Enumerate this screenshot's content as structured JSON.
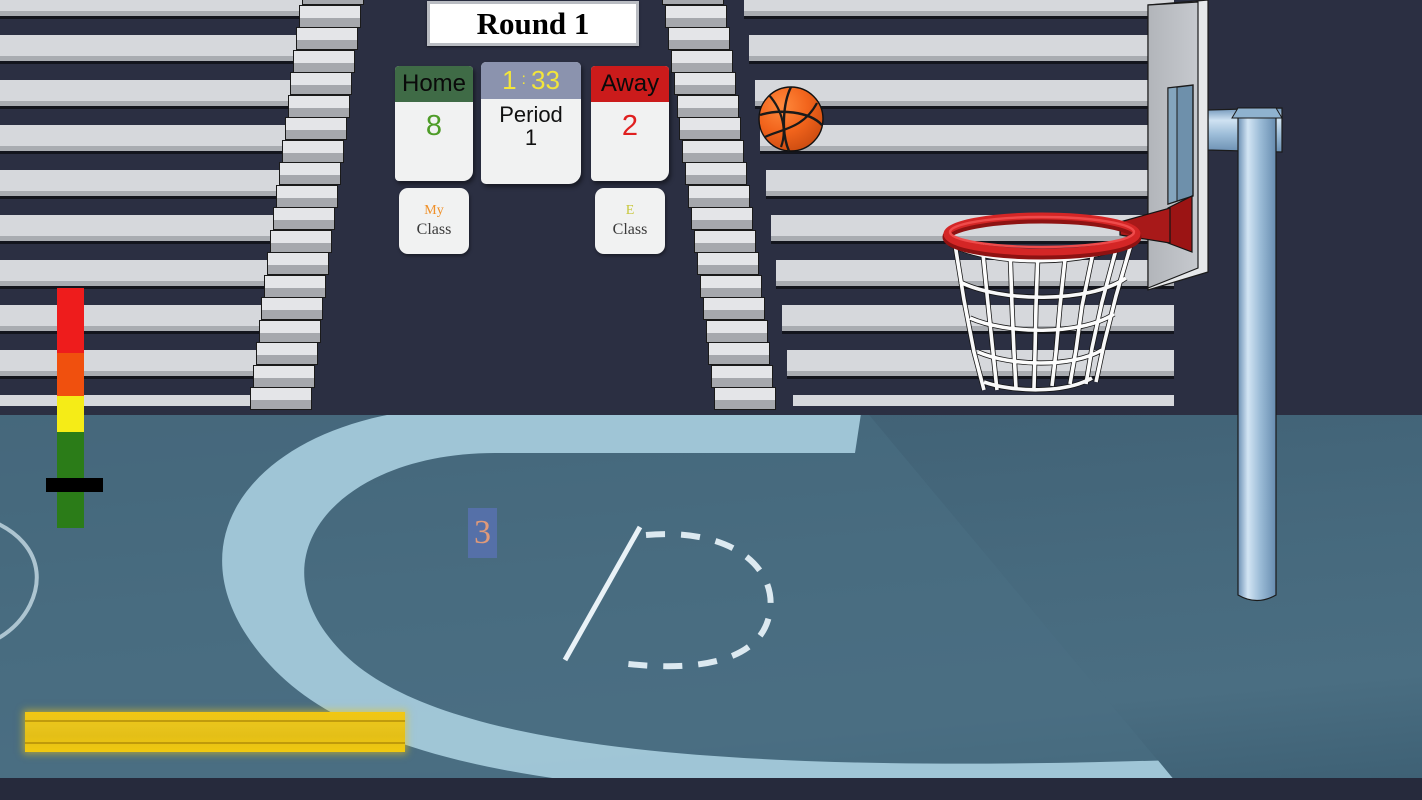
{
  "game": {
    "round_label": "Round 1"
  },
  "scoreboard": {
    "home": {
      "name": "Home",
      "score": "8"
    },
    "away": {
      "name": "Away",
      "score": "2"
    },
    "timer": {
      "minutes": "1",
      "separator": ":",
      "seconds": "33",
      "period_label": "Period",
      "period_number": "1"
    },
    "home_class": {
      "tag": "My",
      "sub": "Class"
    },
    "away_class": {
      "tag": "E",
      "sub": "Class"
    }
  },
  "hud": {
    "three_point_badge": "3",
    "power_meter": {
      "segments": [
        {
          "name": "red",
          "color": "#ee1c1c",
          "height_pct": 27
        },
        {
          "name": "orange",
          "color": "#f0500e",
          "height_pct": 18
        },
        {
          "name": "yellow",
          "color": "#f5ec17",
          "height_pct": 15
        },
        {
          "name": "green",
          "color": "#2b7c18",
          "height_pct": 40
        }
      ],
      "indicator_position_pct": 82
    },
    "shot_bar": {
      "fill_pct": 100,
      "color": "#ecc416"
    }
  },
  "colors": {
    "background": "#2b2f42",
    "bleacher_row": "#d6d8dc",
    "bleacher_gap": "#111c38",
    "court_floor": "#46697d",
    "court_paint": "#a7cddd",
    "rim": "#cc2222",
    "ball": "#f1641e",
    "pole": "#9fc0dc",
    "backboard": "#b9bcc0",
    "home_accent": "#3f6b46",
    "away_accent": "#cb1b1b",
    "timer_accent": "#f2e53b"
  }
}
